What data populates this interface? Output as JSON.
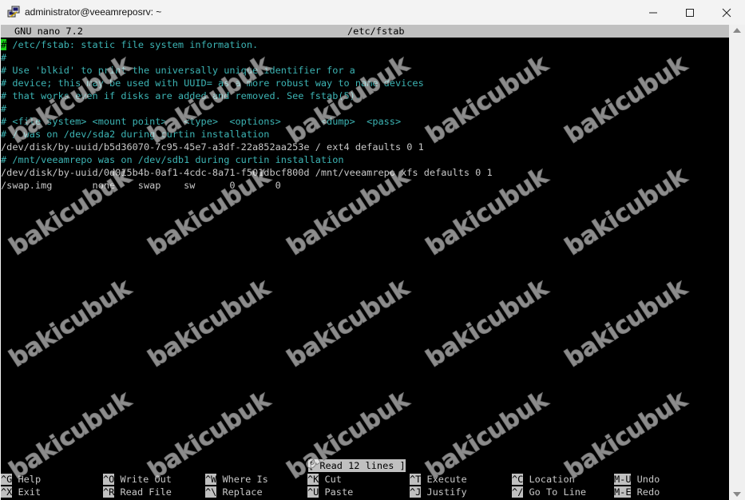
{
  "window": {
    "title": "administrator@veeamreposrv: ~",
    "icon": "putty-icon"
  },
  "header": {
    "app": "GNU nano 7.2",
    "file": "/etc/fstab"
  },
  "lines": [
    {
      "kind": "comment-cursor",
      "text": " /etc/fstab: static file system information."
    },
    {
      "kind": "comment",
      "text": "#"
    },
    {
      "kind": "comment",
      "text": "# Use 'blkid' to print the universally unique identifier for a"
    },
    {
      "kind": "comment",
      "text": "# device; this may be used with UUID= as a more robust way to name devices"
    },
    {
      "kind": "comment",
      "text": "# that works even if disks are added and removed. See fstab(5)."
    },
    {
      "kind": "comment",
      "text": "#"
    },
    {
      "kind": "comment",
      "text": "# <file system> <mount point>   <type>  <options>       <dump>  <pass>"
    },
    {
      "kind": "comment",
      "text": "# / was on /dev/sda2 during curtin installation"
    },
    {
      "kind": "plain",
      "text": "/dev/disk/by-uuid/b5d36070-7c95-45e7-a3df-22a852aa253e / ext4 defaults 0 1"
    },
    {
      "kind": "comment",
      "text": "# /mnt/veeamrepo was on /dev/sdb1 during curtin installation"
    },
    {
      "kind": "plain",
      "text": "/dev/disk/by-uuid/0d015b4b-0af1-4cdc-8a71-f501dbcf800d /mnt/veeamrepo xfs defaults 0 1"
    },
    {
      "kind": "plain",
      "text": "/swap.img       none    swap    sw      0       0"
    }
  ],
  "status_message": "[ Read 12 lines ]",
  "shortcuts": [
    [
      {
        "key": "^G",
        "label": "Help"
      },
      {
        "key": "^X",
        "label": "Exit"
      }
    ],
    [
      {
        "key": "^O",
        "label": "Write Out"
      },
      {
        "key": "^R",
        "label": "Read File"
      }
    ],
    [
      {
        "key": "^W",
        "label": "Where Is"
      },
      {
        "key": "^\\",
        "label": "Replace"
      }
    ],
    [
      {
        "key": "^K",
        "label": "Cut"
      },
      {
        "key": "^U",
        "label": "Paste"
      }
    ],
    [
      {
        "key": "^T",
        "label": "Execute"
      },
      {
        "key": "^J",
        "label": "Justify"
      }
    ],
    [
      {
        "key": "^C",
        "label": "Location"
      },
      {
        "key": "^/",
        "label": "Go To Line"
      }
    ],
    [
      {
        "key": "M-U",
        "label": "Undo"
      },
      {
        "key": "M-E",
        "label": "Redo"
      }
    ]
  ],
  "watermark": "bakicubuk",
  "colors": {
    "comment": "#3cb4b4",
    "text": "#c8c8c8",
    "bar": "#c0c0c0",
    "cursor": "#19d419",
    "background": "#000000"
  }
}
